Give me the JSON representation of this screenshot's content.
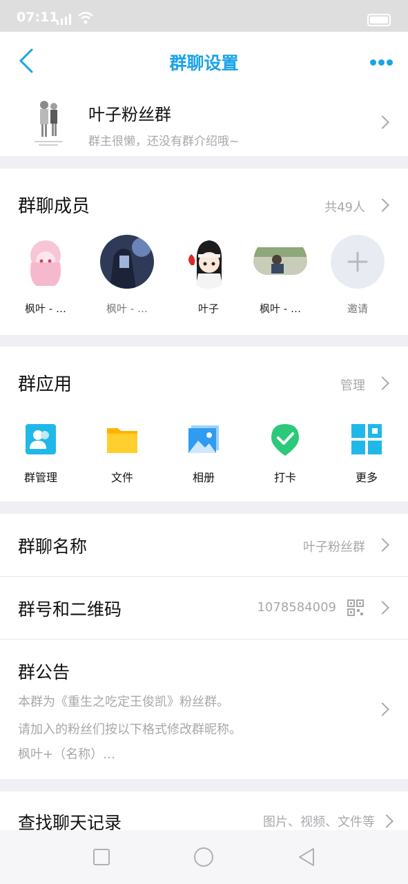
{
  "status_bar": {
    "time": "07:11"
  },
  "nav": {
    "title": "群聊设置"
  },
  "group": {
    "name": "叶子粉丝群",
    "desc": "群主很懒，还没有群介绍哦~"
  },
  "members": {
    "title": "群聊成员",
    "count": "共49人",
    "list": [
      {
        "name": "枫叶 - …"
      },
      {
        "name": "枫叶 - …"
      },
      {
        "name": "叶子"
      },
      {
        "name": "枫叶 - …"
      },
      {
        "name": "邀请"
      }
    ]
  },
  "apps": {
    "title": "群应用",
    "manage": "管理",
    "items": [
      {
        "label": "群管理",
        "icon": "group-manage-icon",
        "color": "#1fb8e8"
      },
      {
        "label": "文件",
        "icon": "folder-icon",
        "color": "#ffc21a"
      },
      {
        "label": "相册",
        "icon": "photo-album-icon",
        "color": "#2f9cf2"
      },
      {
        "label": "打卡",
        "icon": "check-in-icon",
        "color": "#2cc97a"
      },
      {
        "label": "更多",
        "icon": "more-grid-icon",
        "color": "#1fb8e8"
      }
    ]
  },
  "rows": {
    "group_name_label": "群聊名称",
    "group_name_value": "叶子粉丝群",
    "group_id_label": "群号和二维码",
    "group_id_value": "1078584009",
    "notice_label": "群公告",
    "notice_line1": "本群为《重生之吃定王俊凯》粉丝群。",
    "notice_line2": "请加入的粉丝们按以下格式修改群昵称。",
    "notice_line3": "枫叶+（名称）…",
    "search_label": "查找聊天记录",
    "search_value": "图片、视频、文件等"
  },
  "colors": {
    "accent": "#1aa3e6",
    "muted": "#a8a8ac"
  }
}
